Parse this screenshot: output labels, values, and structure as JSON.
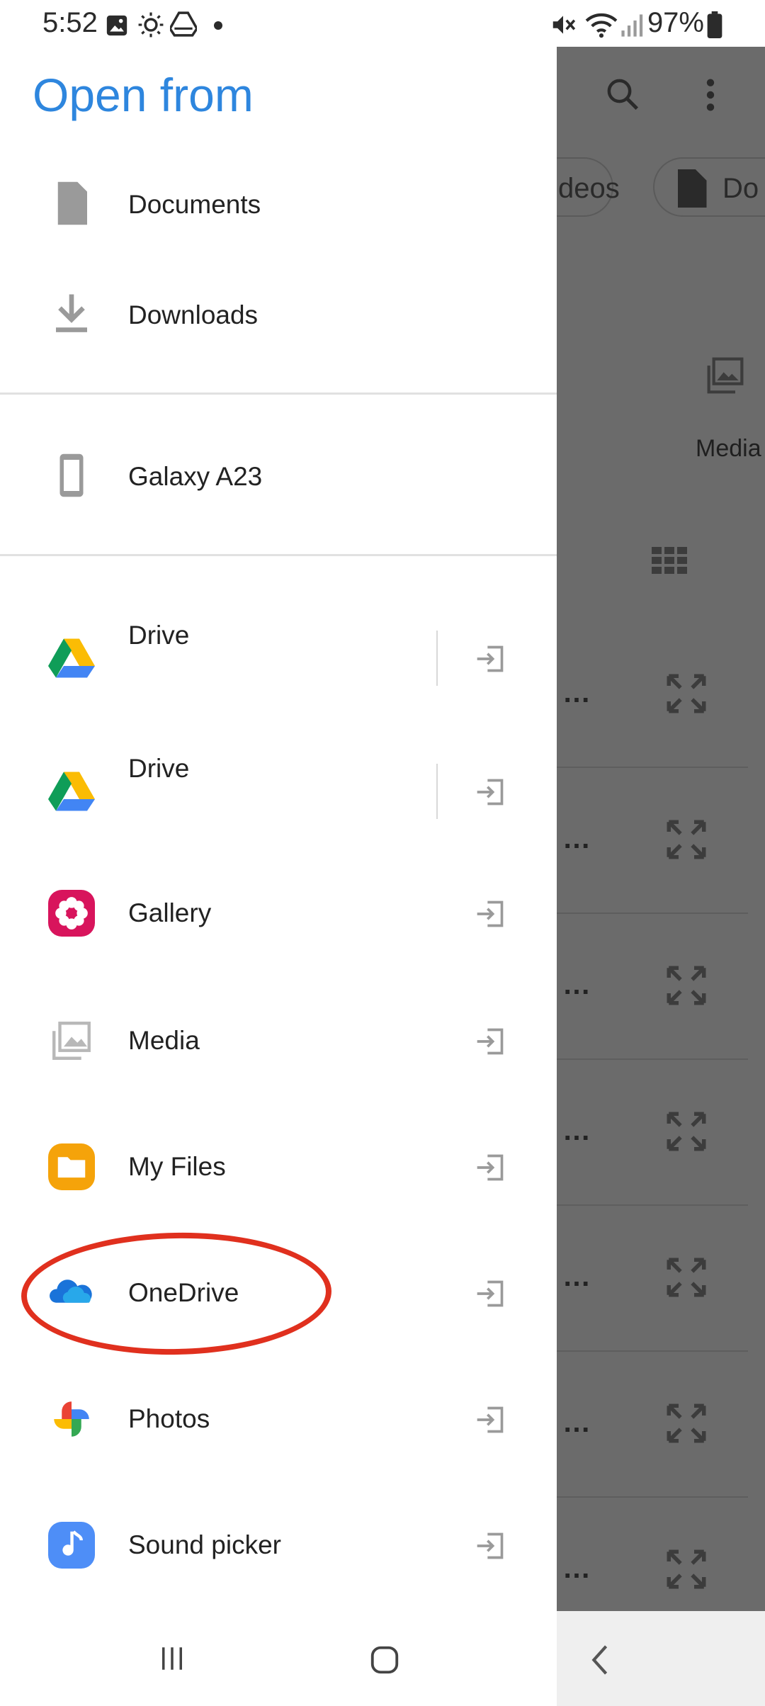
{
  "status_bar": {
    "time": "5:52",
    "battery_text": "97%",
    "icons": [
      "image-icon",
      "brightness-icon",
      "drive-notification-icon",
      "dot-icon",
      "mute-icon",
      "wifi-icon",
      "signal-icon",
      "battery-icon"
    ]
  },
  "drawer": {
    "title": "Open from",
    "sections": {
      "shortcuts": [
        {
          "label": "Documents",
          "icon": "document-icon"
        },
        {
          "label": "Downloads",
          "icon": "download-icon"
        }
      ],
      "devices": [
        {
          "label": "Galaxy A23",
          "icon": "phone-icon"
        }
      ],
      "apps": [
        {
          "label": "Drive",
          "icon": "google-drive-icon"
        },
        {
          "label": "Drive",
          "icon": "google-drive-icon"
        },
        {
          "label": "Gallery",
          "icon": "gallery-icon"
        },
        {
          "label": "Media",
          "icon": "media-icon"
        },
        {
          "label": "My Files",
          "icon": "folder-icon"
        },
        {
          "label": "OneDrive",
          "icon": "onedrive-icon"
        },
        {
          "label": "Photos",
          "icon": "google-photos-icon"
        },
        {
          "label": "Sound picker",
          "icon": "music-note-icon"
        }
      ]
    }
  },
  "background_app": {
    "chip_videos": "deos",
    "chip_docs": "Do",
    "media_label": "Media",
    "row_ellipsis": [
      "…",
      "…",
      "…",
      "…",
      "…",
      "…",
      "…"
    ]
  },
  "colors": {
    "title": "#2e86de",
    "annotation": "#e0301e",
    "scrim": "#6b6b6b"
  }
}
